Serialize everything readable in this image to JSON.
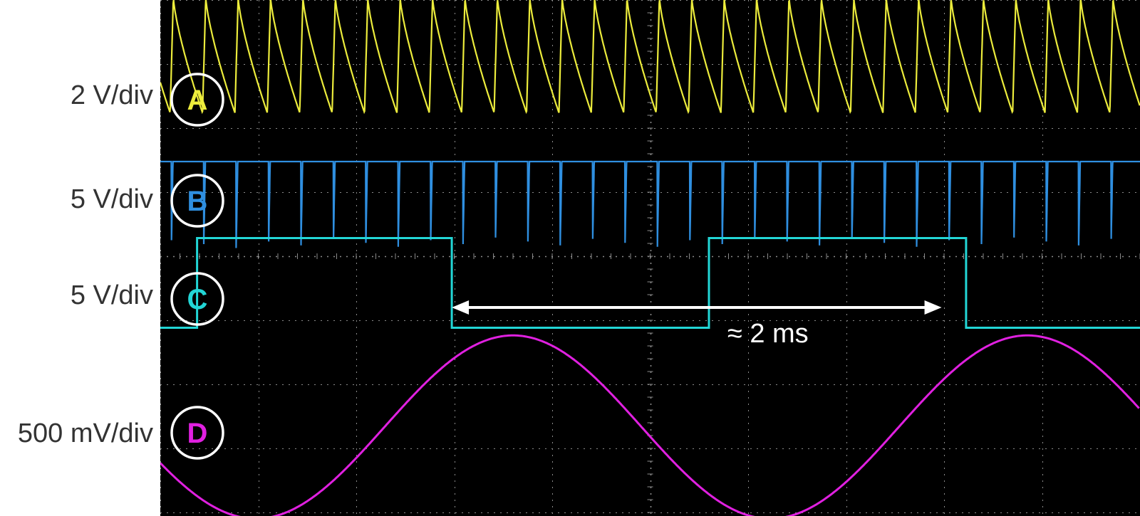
{
  "chart_data": {
    "type": "line",
    "title": "",
    "xlabel": "",
    "ylabel": "",
    "grid": true,
    "background_color": "#000000",
    "grid_color": "#8a8a8a",
    "annotation_color": "#ffffff",
    "x_range_ms": [
      0,
      4.0
    ],
    "annotation": {
      "text": "≈ 2 ms",
      "x_start_ms": 1.19,
      "x_end_ms": 3.19
    },
    "series": [
      {
        "marker": "A",
        "scale": "2 V/div",
        "color": "#ecec3c",
        "waveform": "sawtooth",
        "period_ms": 0.1323,
        "low_div": -0.15,
        "high_div": 1.65
      },
      {
        "marker": "B",
        "scale": "5 V/div",
        "color": "#2f8fe0",
        "waveform": "pulse-train",
        "period_ms": 0.1323,
        "high_div": 0.7,
        "pulse_depth_div": 1.35
      },
      {
        "marker": "C",
        "scale": "5 V/div",
        "color": "#22d6d6",
        "waveform": "square",
        "transitions_ms": [
          0.15,
          1.19,
          2.24,
          3.29
        ],
        "levels_div": [
          -0.45,
          0.95,
          -0.45,
          0.95,
          -0.45
        ],
        "edge_label": "≈ 2 ms"
      },
      {
        "marker": "D",
        "scale": "500 mV/div",
        "color": "#e020e0",
        "waveform": "sine",
        "period_ms": 2.1,
        "amplitude_div": 1.43,
        "peak_ms": 1.44,
        "offset_div": 0
      }
    ]
  }
}
